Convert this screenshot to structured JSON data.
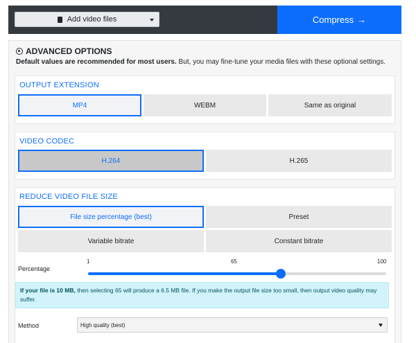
{
  "toolbar": {
    "add_files_label": "Add video files",
    "compress_label": "Compress",
    "compress_arrow": "→",
    "accent": "#0d6efd"
  },
  "advanced": {
    "title": "ADVANCED OPTIONS",
    "subtitle_bold": "Default values are recommended for most users.",
    "subtitle_rest": " But, you may fine-tune your media files with these optional settings."
  },
  "output_extension": {
    "title": "OUTPUT EXTENSION",
    "options": [
      "MP4",
      "WEBM",
      "Same as original"
    ],
    "selected": "MP4"
  },
  "video_codec": {
    "title": "VIDEO CODEC",
    "options": [
      "H.264",
      "H.265"
    ],
    "selected": "H.264"
  },
  "reduce_size": {
    "title": "REDUCE VIDEO FILE SIZE",
    "options": [
      "File size percentage (best)",
      "Preset",
      "Variable bitrate",
      "Constant bitrate"
    ],
    "selected": "File size percentage (best)",
    "slider": {
      "label": "Percentage",
      "min": 1,
      "max": 100,
      "value": 65,
      "min_label": "1",
      "value_label": "65",
      "max_label": "100"
    },
    "info_bold": "If your file is 10 MB,",
    "info_rest": " then selecting 65 will produce a 6.5 MB file. If you make the output file size too small, then output video quality may suffer.",
    "method": {
      "label": "Method",
      "value": "High quality (best)"
    }
  }
}
